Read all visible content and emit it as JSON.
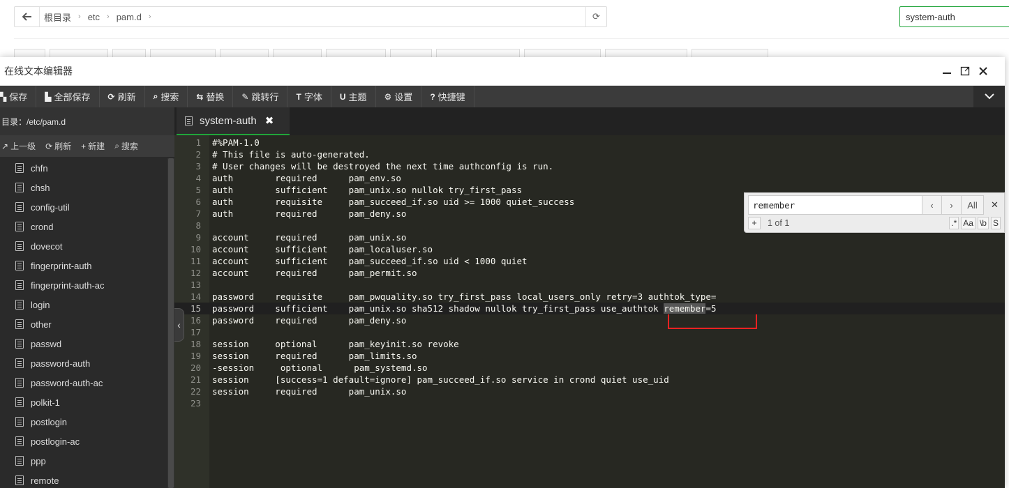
{
  "filemanager": {
    "back_icon": "arrow-left-icon",
    "crumbs": [
      "根目录",
      "etc",
      "pam.d"
    ],
    "search_value": "system-auth"
  },
  "editor": {
    "window_title": "在线文本编辑器",
    "toolbar": [
      {
        "label": "保存",
        "icon": "save-icon",
        "glyph": "▚"
      },
      {
        "label": "全部保存",
        "icon": "save-all-icon",
        "glyph": "▙"
      },
      {
        "label": "刷新",
        "icon": "refresh-icon",
        "glyph": "⟳"
      },
      {
        "label": "搜索",
        "icon": "search-icon",
        "glyph": "⌕"
      },
      {
        "label": "替换",
        "icon": "replace-icon",
        "glyph": "⇆"
      },
      {
        "label": "跳转行",
        "icon": "pin-icon",
        "glyph": "✎"
      },
      {
        "label": "字体",
        "icon": "font-icon",
        "glyph": "T"
      },
      {
        "label": "主题",
        "icon": "magnet-icon",
        "glyph": "U"
      },
      {
        "label": "设置",
        "icon": "gear-icon",
        "glyph": "⚙"
      },
      {
        "label": "快捷键",
        "icon": "help-icon",
        "glyph": "?"
      }
    ],
    "sidebar": {
      "dir_label": "目录：/etc/pam.d",
      "actions": [
        {
          "label": "上一级",
          "glyph": "↗"
        },
        {
          "label": "刷新",
          "glyph": "⟳"
        },
        {
          "label": "新建",
          "glyph": "+"
        },
        {
          "label": "搜索",
          "glyph": "⌕"
        }
      ],
      "files": [
        "chfn",
        "chsh",
        "config-util",
        "crond",
        "dovecot",
        "fingerprint-auth",
        "fingerprint-auth-ac",
        "login",
        "other",
        "passwd",
        "password-auth",
        "password-auth-ac",
        "polkit-1",
        "postlogin",
        "postlogin-ac",
        "ppp",
        "remote"
      ]
    },
    "tab": {
      "label": "system-auth"
    },
    "code_lines": [
      "#%PAM-1.0",
      "# This file is auto-generated.",
      "# User changes will be destroyed the next time authconfig is run.",
      "auth        required      pam_env.so",
      "auth        sufficient    pam_unix.so nullok try_first_pass",
      "auth        requisite     pam_succeed_if.so uid >= 1000 quiet_success",
      "auth        required      pam_deny.so",
      "",
      "account     required      pam_unix.so",
      "account     sufficient    pam_localuser.so",
      "account     sufficient    pam_succeed_if.so uid < 1000 quiet",
      "account     required      pam_permit.so",
      "",
      "password    requisite     pam_pwquality.so try_first_pass local_users_only retry=3 authtok_type=",
      "password    sufficient    pam_unix.so sha512 shadow nullok try_first_pass use_authtok ",
      "password    required      pam_deny.so",
      "",
      "session     optional      pam_keyinit.so revoke",
      "session     required      pam_limits.so",
      "-session     optional      pam_systemd.so",
      "session     [success=1 default=ignore] pam_succeed_if.so service in crond quiet use_uid",
      "session     required      pam_unix.so",
      ""
    ],
    "highlight_word": "remember",
    "highlight_suffix": "=5",
    "active_line": 15,
    "search": {
      "query": "remember",
      "all_label": "All",
      "count": "1 of 1",
      "opts": [
        ".*",
        "Aa",
        "\\b",
        "S"
      ]
    }
  }
}
